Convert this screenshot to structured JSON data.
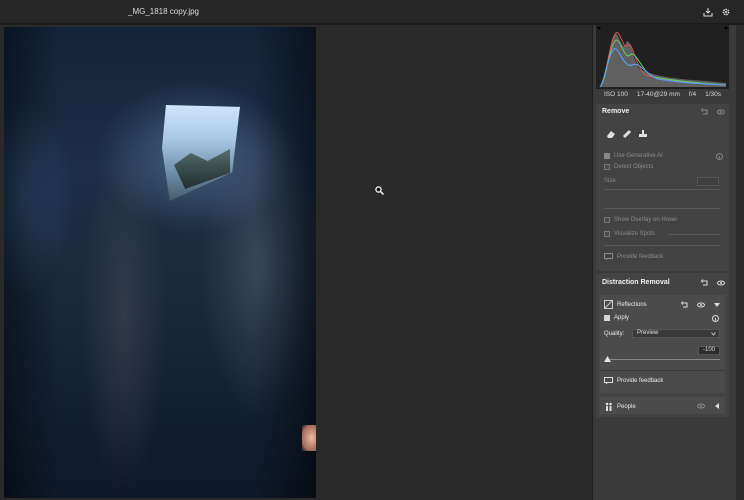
{
  "window": {
    "title": "_MG_1818 copy.jpg"
  },
  "icons": {
    "export": "export-icon",
    "settings": "gear-icon",
    "cursor": "zoom-cursor-icon"
  },
  "camera": {
    "iso": "ISO 100",
    "lens": "17-40@29 mm",
    "aperture": "f/4",
    "shutter": "1/30s"
  },
  "remove": {
    "title": "Remove",
    "use_generative_ai": "Use Generative AI",
    "detect_objects": "Detect Objects",
    "size_label": "Size",
    "show_overlay": "Show Overlay on Hover",
    "visualize_spots": "Visualize Spots",
    "feedback": "Provide feedback"
  },
  "distraction": {
    "title": "Distraction Removal",
    "reflections": {
      "label": "Reflections",
      "apply_label": "Apply",
      "apply_checked": true,
      "quality_label": "Quality:",
      "quality_value": "Preview",
      "amount": "-100",
      "amount_level": 0
    },
    "feedback": "Provide feedback",
    "people": {
      "label": "People"
    }
  },
  "colors": {
    "panel_bg": "#3a3a3a",
    "canvas_bg": "#2a2a2a",
    "accent": "#dcdcdc"
  }
}
